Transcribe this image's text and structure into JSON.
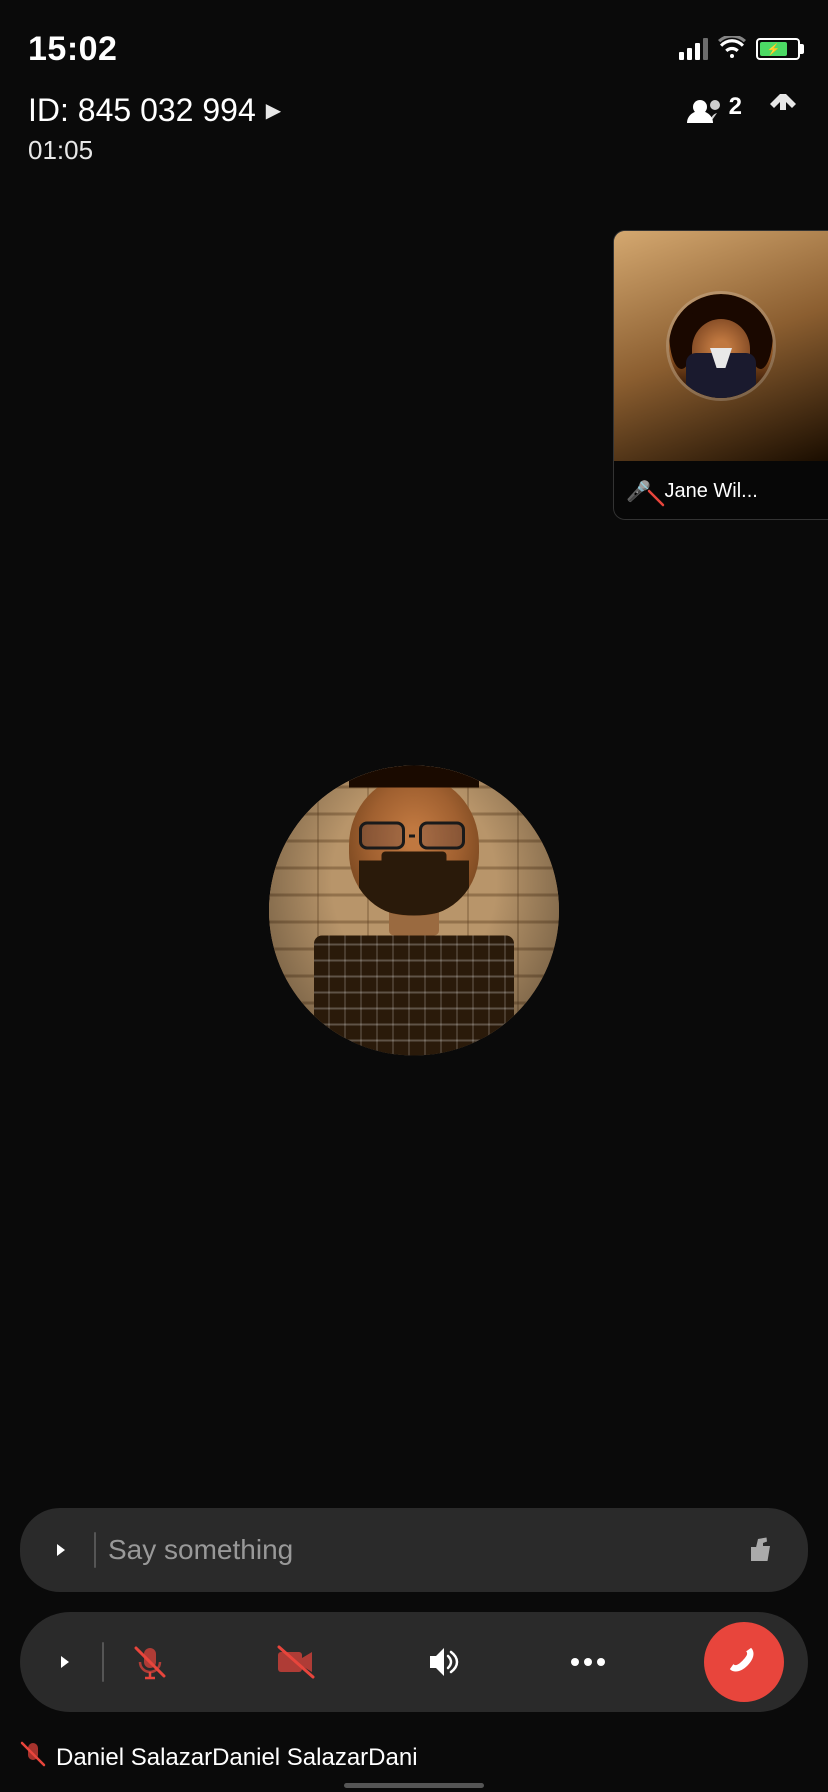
{
  "statusBar": {
    "time": "15:02",
    "batteryIcon": "⚡",
    "wifiIcon": "wifi"
  },
  "callHeader": {
    "idLabel": "ID: 845 032 994",
    "playIcon": "▶",
    "participantsCount": "2",
    "duration": "01:05"
  },
  "pip": {
    "name": "Jane Wil..."
  },
  "mainParticipant": {
    "name": "Daniel Salazar"
  },
  "chatInput": {
    "expandIcon": ">",
    "placeholder": "Say something",
    "thumbIcon": "👍"
  },
  "controls": {
    "expandIcon": ">",
    "muteIcon": "🎤",
    "cameraIcon": "📷",
    "speakerIcon": "🔊",
    "moreIcon": "•••",
    "endCallIcon": "📞"
  },
  "participantBar": {
    "name": "Daniel SalazarDaniel SalazarDani"
  }
}
